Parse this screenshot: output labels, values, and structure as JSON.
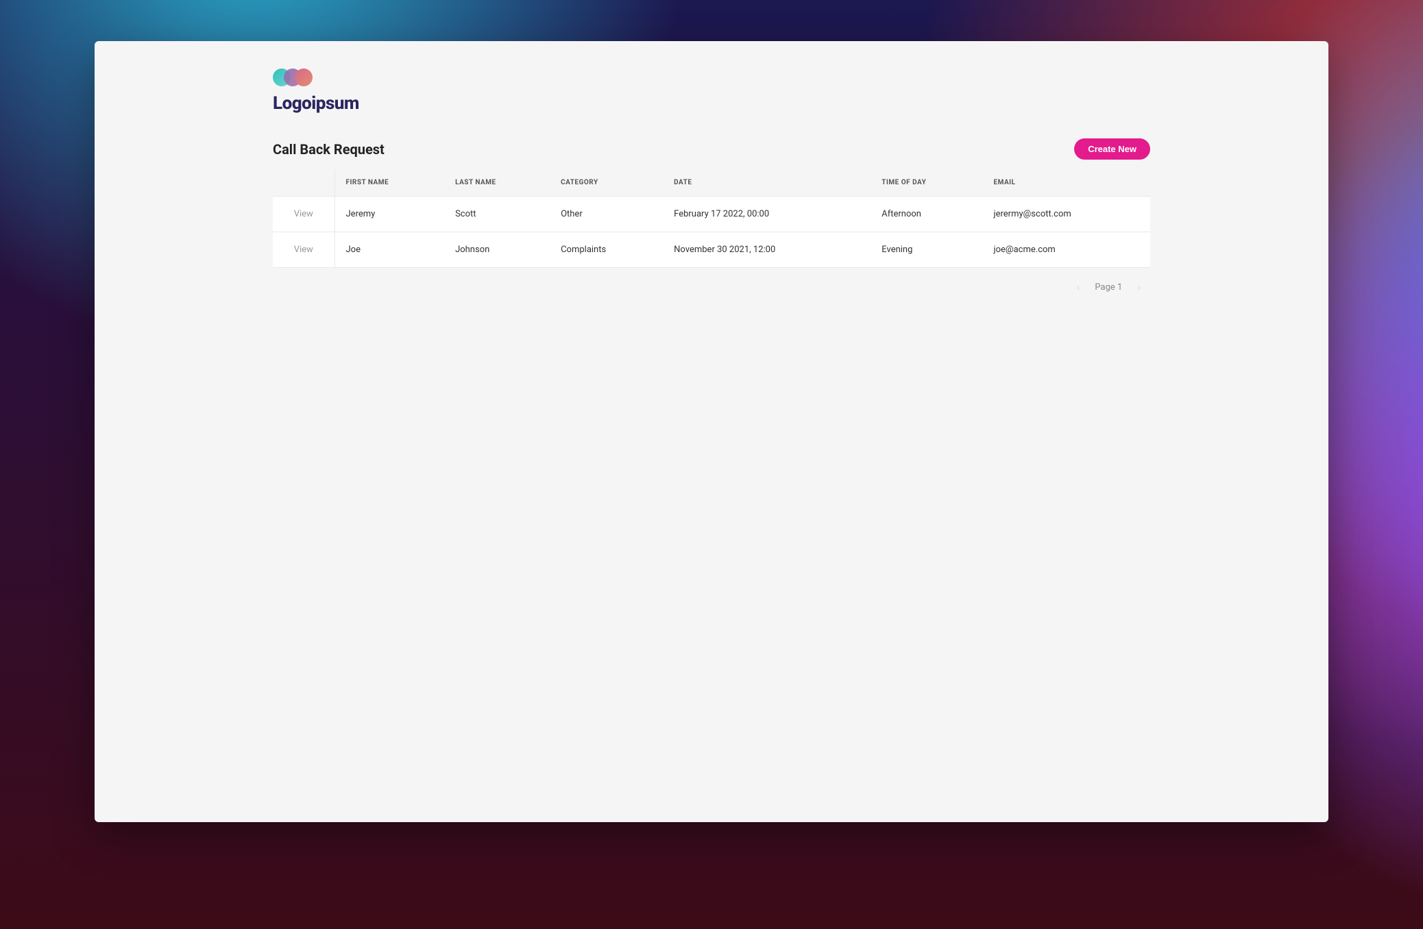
{
  "brand": {
    "name": "Logoipsum"
  },
  "header": {
    "title": "Call Back Request",
    "create_label": "Create New"
  },
  "table": {
    "view_label": "View",
    "columns": {
      "first_name": "First Name",
      "last_name": "Last Name",
      "category": "Category",
      "date": "Date",
      "time_of_day": "Time of Day",
      "email": "Email"
    },
    "rows": [
      {
        "first_name": "Jeremy",
        "last_name": "Scott",
        "category": "Other",
        "date": "February 17 2022, 00:00",
        "time_of_day": "Afternoon",
        "email": "jerermy@scott.com"
      },
      {
        "first_name": "Joe",
        "last_name": "Johnson",
        "category": "Complaints",
        "date": "November 30 2021, 12:00",
        "time_of_day": "Evening",
        "email": "joe@acme.com"
      }
    ]
  },
  "pagination": {
    "label": "Page 1"
  }
}
